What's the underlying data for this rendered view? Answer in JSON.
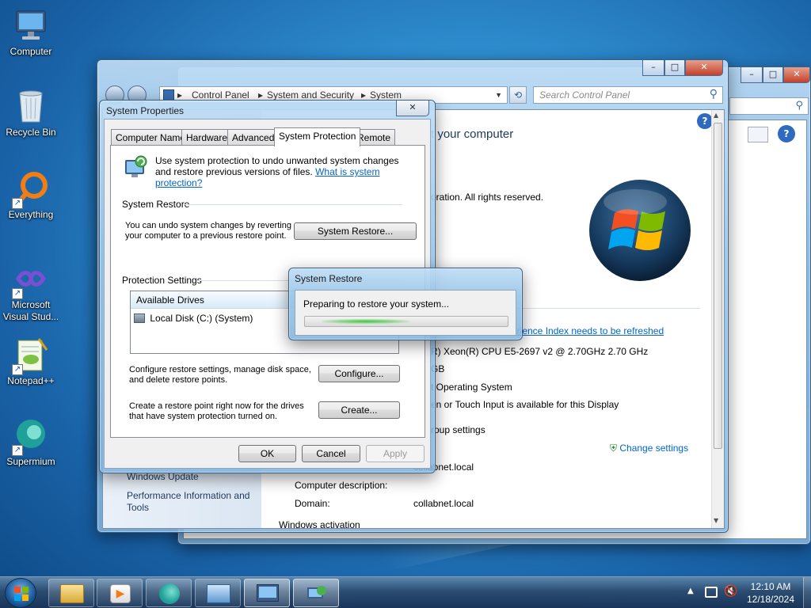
{
  "desktop": {
    "icons": [
      {
        "label": "Computer"
      },
      {
        "label": "Recycle Bin"
      },
      {
        "label": "Everything"
      },
      {
        "label_line1": "Microsoft",
        "label_line2": "Visual Stud..."
      },
      {
        "label": "Notepad++"
      },
      {
        "label": "Supermium"
      }
    ]
  },
  "control_panel": {
    "breadcrumb": [
      "Control Panel",
      "System and Security",
      "System"
    ],
    "search_placeholder": "Search Control Panel",
    "heading_partial": "t your computer",
    "copyright_partial": "oration.  All rights reserved.",
    "rating_link_partial": "erience Index needs to be refreshed",
    "processor_partial": "R) Xeon(R) CPU E5-2697 v2 @ 2.70GHz   2.70 GHz",
    "ram_partial": "GB",
    "system_type_partial": "t Operating System",
    "pen_partial": "en or Touch Input is available for this Display",
    "group_settings_partial": "roup settings",
    "change_settings": "Change settings",
    "full_computer_name_partial": "collabnet.local",
    "computer_description_label": "Computer description:",
    "domain_label": "Domain:",
    "domain_value": "collabnet.local",
    "windows_activation_partial": "Windows activation",
    "sidebar_links": [
      "Windows Update",
      "Performance Information and Tools"
    ]
  },
  "system_properties": {
    "title": "System Properties",
    "tabs": [
      "Computer Name",
      "Hardware",
      "Advanced",
      "System Protection",
      "Remote"
    ],
    "intro_text": "Use system protection to undo unwanted system changes and restore previous versions of files.",
    "intro_link": "What is system protection?",
    "system_restore_heading": "System Restore",
    "system_restore_text": "You can undo system changes by reverting your computer to a previous restore point.",
    "system_restore_button": "System Restore...",
    "protection_heading": "Protection Settings",
    "drives_header": "Available Drives",
    "drives": [
      {
        "name": "Local Disk (C:) (System)"
      }
    ],
    "configure_text": "Configure restore settings, manage disk space, and delete restore points.",
    "configure_button": "Configure...",
    "create_text": "Create a restore point right now for the drives that have system protection turned on.",
    "create_button": "Create...",
    "ok_button": "OK",
    "cancel_button": "Cancel",
    "apply_button": "Apply"
  },
  "restore_dialog": {
    "title": "System Restore",
    "message": "Preparing to restore your system..."
  },
  "taskbar": {
    "time": "12:10 AM",
    "date": "12/18/2024"
  },
  "colors": {
    "link": "#0066cc",
    "window_frame": "#b5d3ee",
    "close_button": "#c4412a",
    "progress_green": "#3cc93c"
  }
}
